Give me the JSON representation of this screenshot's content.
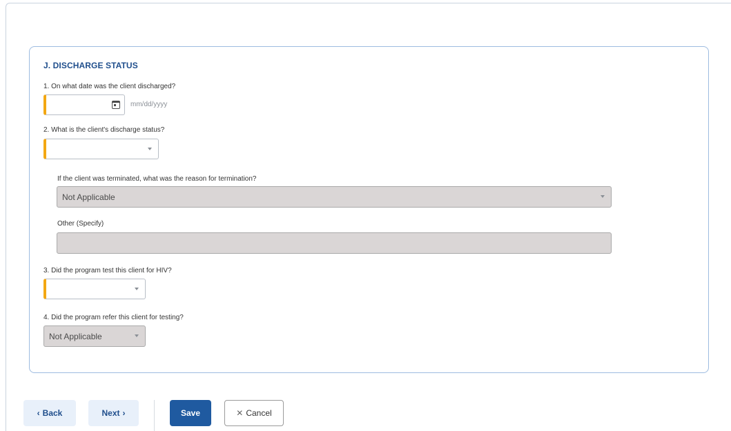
{
  "section": {
    "title": "J. DISCHARGE STATUS"
  },
  "questions": {
    "q1": {
      "label": "1. On what date was the client discharged?",
      "value": "",
      "hint": "mm/dd/yyyy"
    },
    "q2": {
      "label": "2. What is the client's discharge status?",
      "value": ""
    },
    "termination_reason": {
      "label": "If the client was terminated, what was the reason for termination?",
      "value": "Not Applicable"
    },
    "other_specify": {
      "label": "Other (Specify)",
      "value": ""
    },
    "q3": {
      "label": "3. Did the program test this client for HIV?",
      "value": ""
    },
    "q4": {
      "label": "4. Did the program refer this client for testing?",
      "value": "Not Applicable"
    }
  },
  "footer": {
    "back_label": "Back",
    "next_label": "Next",
    "save_label": "Save",
    "cancel_label": "Cancel"
  },
  "colors": {
    "accent": "#1f5aa0",
    "title": "#1f4e8c",
    "required": "#f3a712",
    "disabled_bg": "#dad6d6",
    "panel_border": "#9dbbe0"
  }
}
